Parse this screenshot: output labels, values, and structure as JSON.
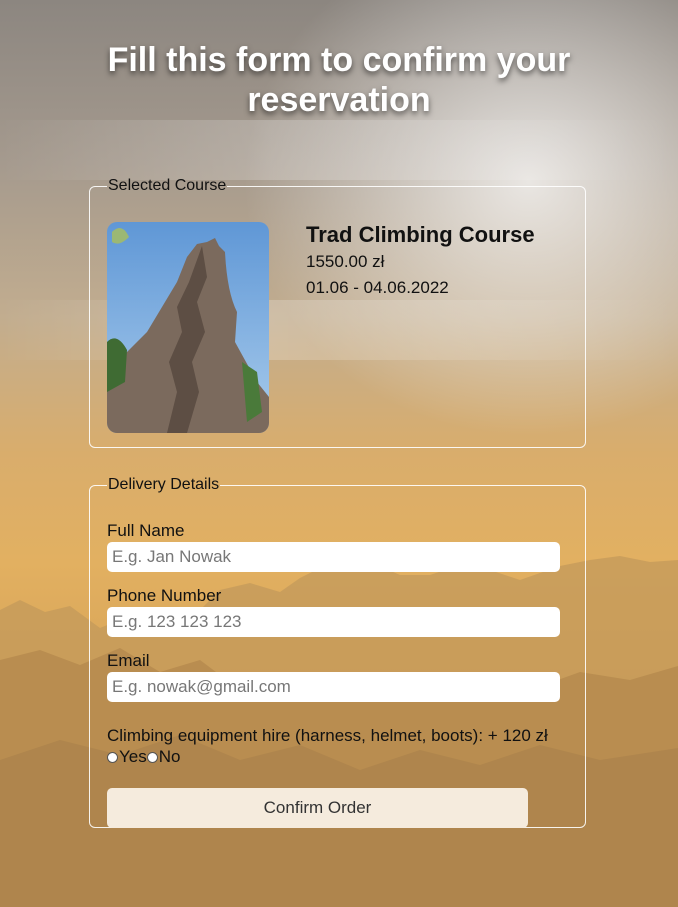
{
  "page": {
    "title": "Fill this form to confirm your reservation"
  },
  "course_section": {
    "legend": "Selected Course",
    "name": "Trad Climbing Course",
    "price": "1550.00 zł",
    "dates": "01.06 - 04.06.2022"
  },
  "delivery_section": {
    "legend": "Delivery Details",
    "full_name": {
      "label": "Full Name",
      "placeholder": "E.g. Jan Nowak"
    },
    "phone": {
      "label": "Phone Number",
      "placeholder": "E.g. 123 123 123"
    },
    "email": {
      "label": "Email",
      "placeholder": "E.g. nowak@gmail.com"
    },
    "equipment_label": "Climbing equipment hire (harness, helmet, boots): + 120 zł",
    "yes_label": "Yes",
    "no_label": "No",
    "confirm_label": "Confirm Order"
  }
}
